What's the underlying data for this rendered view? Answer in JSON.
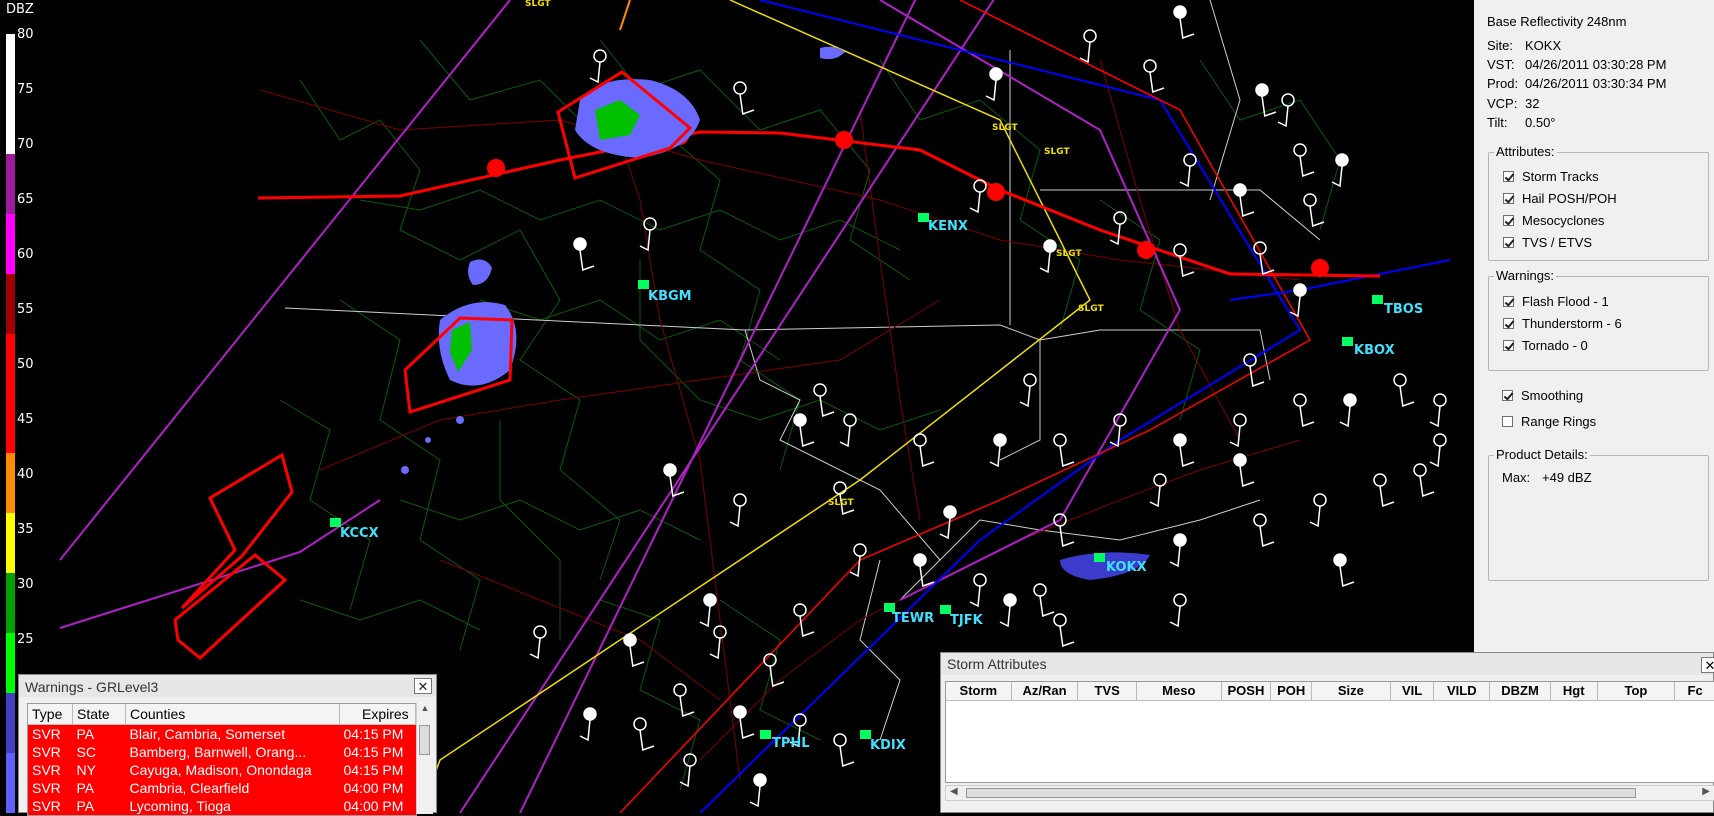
{
  "legend": {
    "title": "DBZ",
    "ticks": [
      "80",
      "75",
      "70",
      "65",
      "60",
      "55",
      "50",
      "45",
      "40",
      "35",
      "30",
      "25"
    ],
    "colors": [
      "#ffffff",
      "#ffffff",
      "#9c1a9c",
      "#ff00ff",
      "#a00000",
      "#ff0000",
      "#ff0000",
      "#ff8c00",
      "#ffff00",
      "#00a000",
      "#00ff00",
      "#4040c0",
      "#6060ff"
    ]
  },
  "sites": [
    {
      "id": "KENX"
    },
    {
      "id": "KBGM"
    },
    {
      "id": "TBOS"
    },
    {
      "id": "KBOX"
    },
    {
      "id": "KCCX"
    },
    {
      "id": "KOKX"
    },
    {
      "id": "TEWR"
    },
    {
      "id": "TJFK"
    },
    {
      "id": "TPHL"
    },
    {
      "id": "KDIX"
    }
  ],
  "outlook_labels": [
    "SLGT",
    "SLGT",
    "SLGT",
    "SLGT",
    "SLGT",
    "SLGT"
  ],
  "info": {
    "product": "Base Reflectivity 248nm",
    "site_label": "Site:",
    "site_value": "KOKX",
    "vst_label": "VST:",
    "vst_value": "04/26/2011  03:30:28 PM",
    "prod_label": "Prod:",
    "prod_value": "04/26/2011  03:30:34 PM",
    "vcp_label": "VCP:",
    "vcp_value": "32",
    "tilt_label": "Tilt:",
    "tilt_value": "0.50°"
  },
  "attributes": {
    "title": "Attributes:",
    "items": [
      {
        "label": "Storm Tracks",
        "checked": true
      },
      {
        "label": "Hail POSH/POH",
        "checked": true
      },
      {
        "label": "Mesocyclones",
        "checked": true
      },
      {
        "label": "TVS / ETVS",
        "checked": true
      }
    ]
  },
  "warnings_group": {
    "title": "Warnings:",
    "items": [
      {
        "label": "Flash Flood - 1",
        "checked": true
      },
      {
        "label": "Thunderstorm - 6",
        "checked": true
      },
      {
        "label": "Tornado - 0",
        "checked": true
      }
    ]
  },
  "options": {
    "smoothing": {
      "label": "Smoothing",
      "checked": true
    },
    "range_rings": {
      "label": "Range Rings",
      "checked": false
    }
  },
  "product_details": {
    "title": "Product Details:",
    "max_label": "Max:",
    "max_value": "+49 dBZ"
  },
  "warnings_window": {
    "title": "Warnings - GRLevel3",
    "close": "✕",
    "columns": [
      "Type",
      "State",
      "Counties",
      "Expires"
    ],
    "rows": [
      {
        "type": "SVR",
        "state": "PA",
        "counties": "Blair, Cambria, Somerset",
        "expires": "04:15 PM"
      },
      {
        "type": "SVR",
        "state": "SC",
        "counties": "Bamberg, Barnwell, Orang...",
        "expires": "04:15 PM"
      },
      {
        "type": "SVR",
        "state": "NY",
        "counties": "Cayuga, Madison, Onondaga",
        "expires": "04:15 PM"
      },
      {
        "type": "SVR",
        "state": "PA",
        "counties": "Cambria, Clearfield",
        "expires": "04:00 PM"
      },
      {
        "type": "SVR",
        "state": "PA",
        "counties": "Lycoming, Tioga",
        "expires": "04:00 PM"
      }
    ]
  },
  "storm_window": {
    "title": "Storm Attributes",
    "close": "✕",
    "columns": [
      "Storm",
      "Az/Ran",
      "TVS",
      "Meso",
      "POSH",
      "POH",
      "Size",
      "VIL",
      "VILD",
      "DBZM",
      "Hgt",
      "Top",
      "Fc"
    ]
  }
}
